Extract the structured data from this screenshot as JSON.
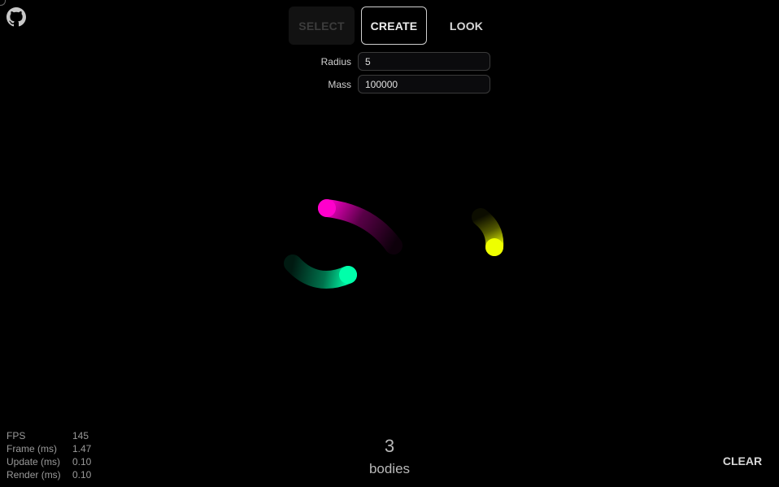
{
  "toolbar": {
    "modes": [
      {
        "label": "SELECT",
        "state": "disabled"
      },
      {
        "label": "CREATE",
        "state": "active"
      },
      {
        "label": "LOOK",
        "state": "normal"
      }
    ]
  },
  "params": {
    "radius": {
      "label": "Radius",
      "value": "5"
    },
    "mass": {
      "label": "Mass",
      "value": "100000"
    }
  },
  "stats": [
    {
      "key": "FPS",
      "value": "145"
    },
    {
      "key": "Frame (ms)",
      "value": "1.47"
    },
    {
      "key": "Update (ms)",
      "value": "0.10"
    },
    {
      "key": "Render (ms)",
      "value": "0.10"
    }
  ],
  "bodies": {
    "count": "3",
    "label": "bodies",
    "items": [
      {
        "color": "#ff00cc",
        "icon": "magenta-body"
      },
      {
        "color": "#00ffaa",
        "icon": "green-body"
      },
      {
        "color": "#eeff00",
        "icon": "yellow-body"
      }
    ]
  },
  "actions": {
    "clear_label": "CLEAR"
  },
  "icons": {
    "github": "github-icon"
  }
}
